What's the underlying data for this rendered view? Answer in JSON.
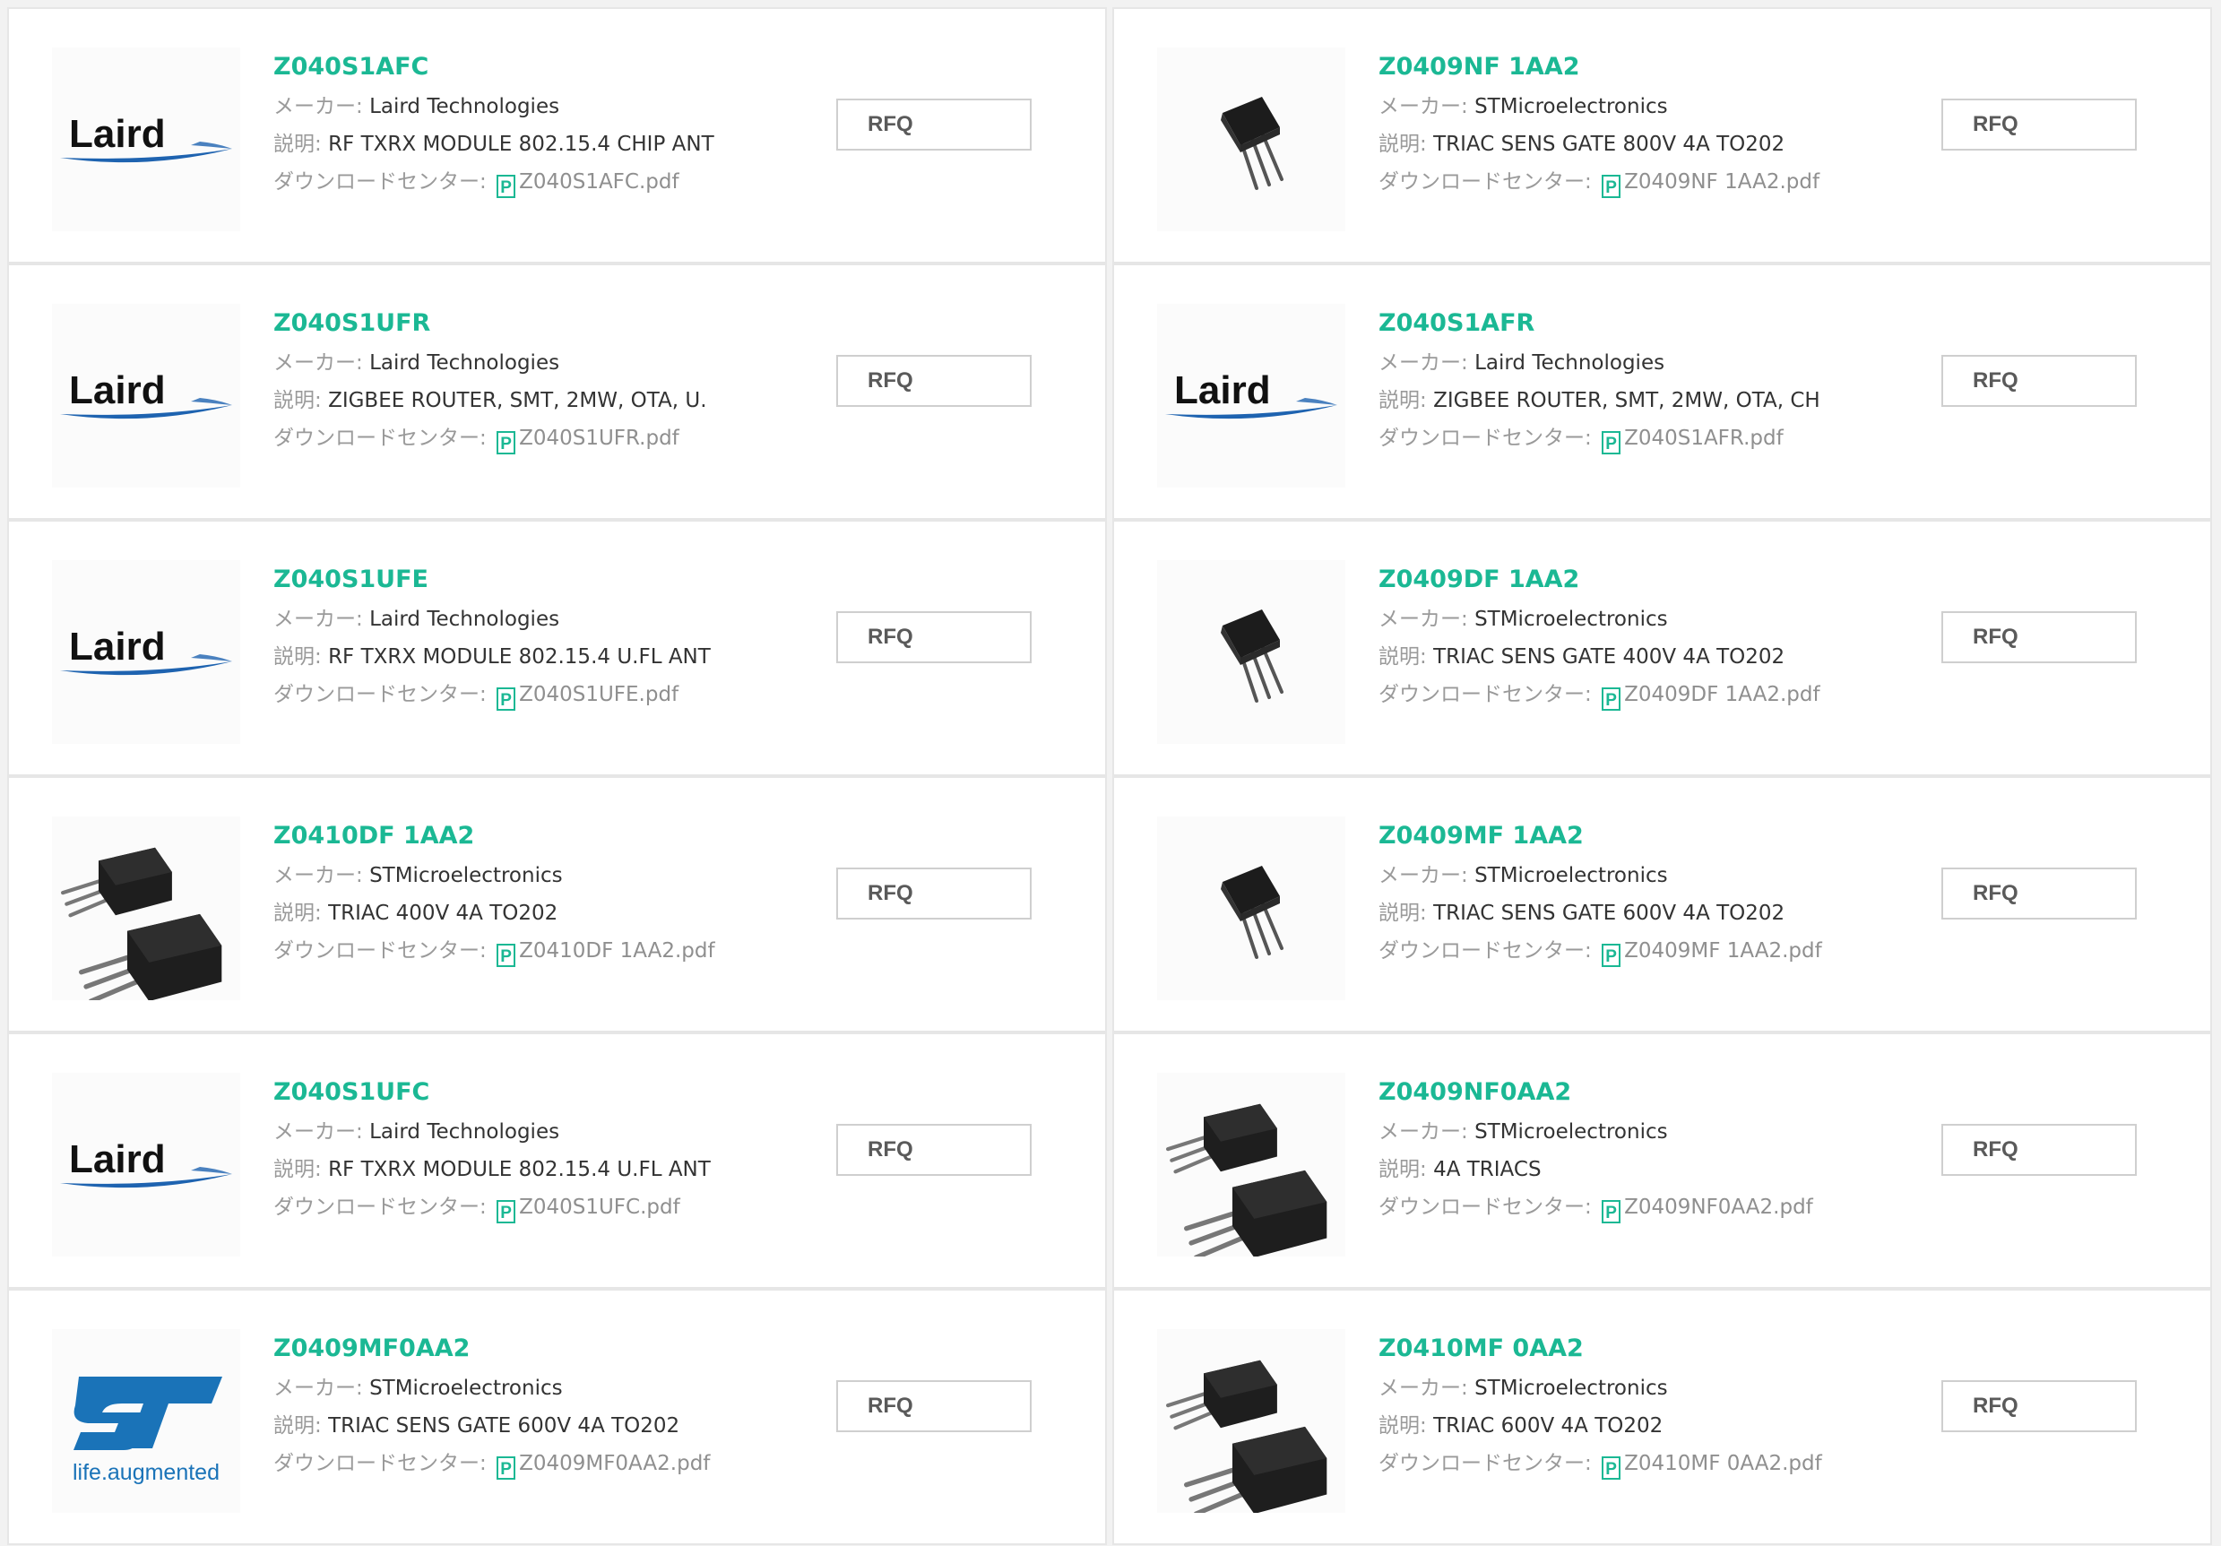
{
  "labels": {
    "maker": "メーカー: ",
    "description": "説明: ",
    "download": "ダウンロードセンター: ",
    "rfq": "RFQ",
    "pdf_glyph": "P"
  },
  "colors": {
    "accent": "#1bb894",
    "laird_blue": "#1e63b0",
    "st_blue": "#1a73b8"
  },
  "products": [
    {
      "part": "Z040S1AFC",
      "maker": "Laird Technologies",
      "desc": "RF TXRX MODULE 802.15.4 CHIP ANT",
      "pdf": "Z040S1AFC.pdf",
      "image": "laird-logo",
      "logo_text": "Laird"
    },
    {
      "part": "Z0409NF 1AA2",
      "maker": "STMicroelectronics",
      "desc": "TRIAC SENS GATE 800V 4A TO202",
      "pdf": "Z0409NF 1AA2.pdf",
      "image": "to202-single"
    },
    {
      "part": "Z040S1UFR",
      "maker": "Laird Technologies",
      "desc": "ZIGBEE ROUTER, SMT, 2MW, OTA, U.",
      "pdf": "Z040S1UFR.pdf",
      "image": "laird-logo",
      "logo_text": "Laird"
    },
    {
      "part": "Z040S1AFR",
      "maker": "Laird Technologies",
      "desc": "ZIGBEE ROUTER, SMT, 2MW, OTA, CH",
      "pdf": "Z040S1AFR.pdf",
      "image": "laird-logo",
      "logo_text": "Laird"
    },
    {
      "part": "Z040S1UFE",
      "maker": "Laird Technologies",
      "desc": "RF TXRX MODULE 802.15.4 U.FL ANT",
      "pdf": "Z040S1UFE.pdf",
      "image": "laird-logo",
      "logo_text": "Laird"
    },
    {
      "part": "Z0409DF 1AA2",
      "maker": "STMicroelectronics",
      "desc": "TRIAC SENS GATE 400V 4A TO202",
      "pdf": "Z0409DF 1AA2.pdf",
      "image": "to202-single"
    },
    {
      "part": "Z0410DF 1AA2",
      "maker": "STMicroelectronics",
      "desc": "TRIAC 400V 4A TO202",
      "pdf": "Z0410DF 1AA2.pdf",
      "image": "to202-pair"
    },
    {
      "part": "Z0409MF 1AA2",
      "maker": "STMicroelectronics",
      "desc": "TRIAC SENS GATE 600V 4A TO202",
      "pdf": "Z0409MF 1AA2.pdf",
      "image": "to202-single"
    },
    {
      "part": "Z040S1UFC",
      "maker": "Laird Technologies",
      "desc": "RF TXRX MODULE 802.15.4 U.FL ANT",
      "pdf": "Z040S1UFC.pdf",
      "image": "laird-logo",
      "logo_text": "Laird"
    },
    {
      "part": "Z0409NF0AA2",
      "maker": "STMicroelectronics",
      "desc": "4A TRIACS",
      "pdf": "Z0409NF0AA2.pdf",
      "image": "to202-pair"
    },
    {
      "part": "Z0409MF0AA2",
      "maker": "STMicroelectronics",
      "desc": "TRIAC SENS GATE 600V 4A TO202",
      "pdf": "Z0409MF0AA2.pdf",
      "image": "st-logo",
      "logo_text": "life.augmented"
    },
    {
      "part": "Z0410MF 0AA2",
      "maker": "STMicroelectronics",
      "desc": "TRIAC 600V 4A TO202",
      "pdf": "Z0410MF 0AA2.pdf",
      "image": "to202-pair"
    }
  ]
}
